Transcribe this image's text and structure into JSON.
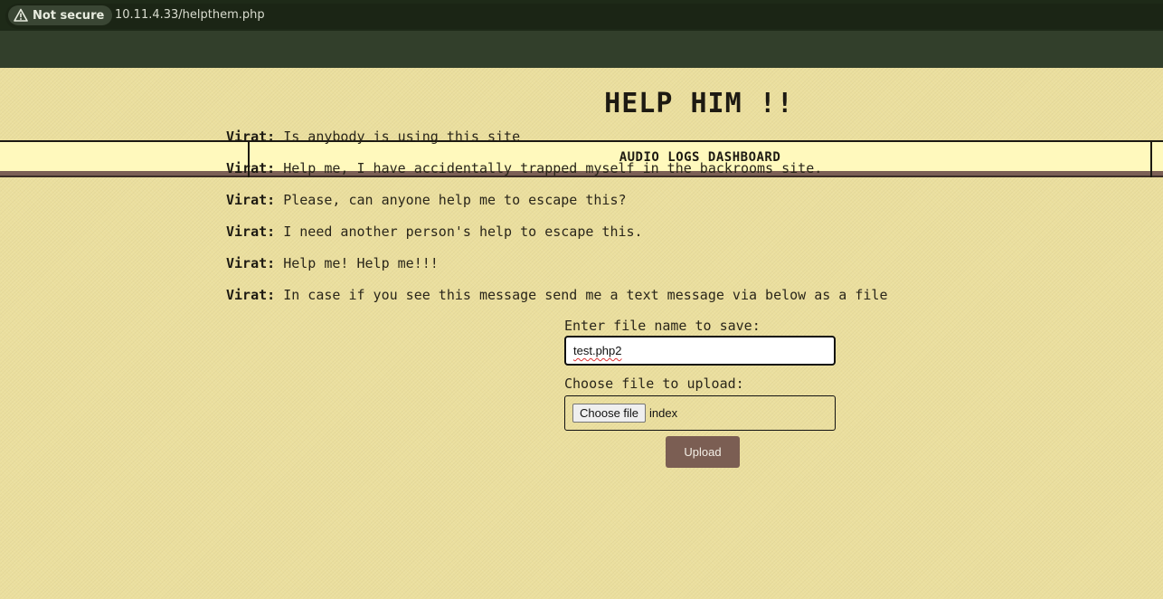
{
  "browser": {
    "security_label": "Not secure",
    "url": "10.11.4.33/helpthem.php"
  },
  "page": {
    "title": "HELP HIM !!",
    "nav_label": "AUDIO LOGS DASHBOARD"
  },
  "log": [
    {
      "speaker": "Virat:",
      "message": "Is anybody is using this site"
    },
    {
      "speaker": "Virat:",
      "message": "Help me, I have accidentally trapped myself in the backrooms site."
    },
    {
      "speaker": "Virat:",
      "message": "Please, can anyone help me to escape this?"
    },
    {
      "speaker": "Virat:",
      "message": "I need another person's help to escape this."
    },
    {
      "speaker": "Virat:",
      "message": "Help me! Help me!!!"
    },
    {
      "speaker": "Virat:",
      "message": "In case if you see this message send me a text message via below as a file"
    }
  ],
  "form": {
    "filename_label": "Enter file name to save:",
    "filename_value": "test.php2",
    "file_label": "Choose file to upload:",
    "choose_button": "Choose file",
    "chosen_file": "index",
    "upload_button": "Upload"
  },
  "colors": {
    "page_background": "#ebdf9e",
    "nav_background": "#fff9bd",
    "accent_brown": "#7b5e53"
  }
}
